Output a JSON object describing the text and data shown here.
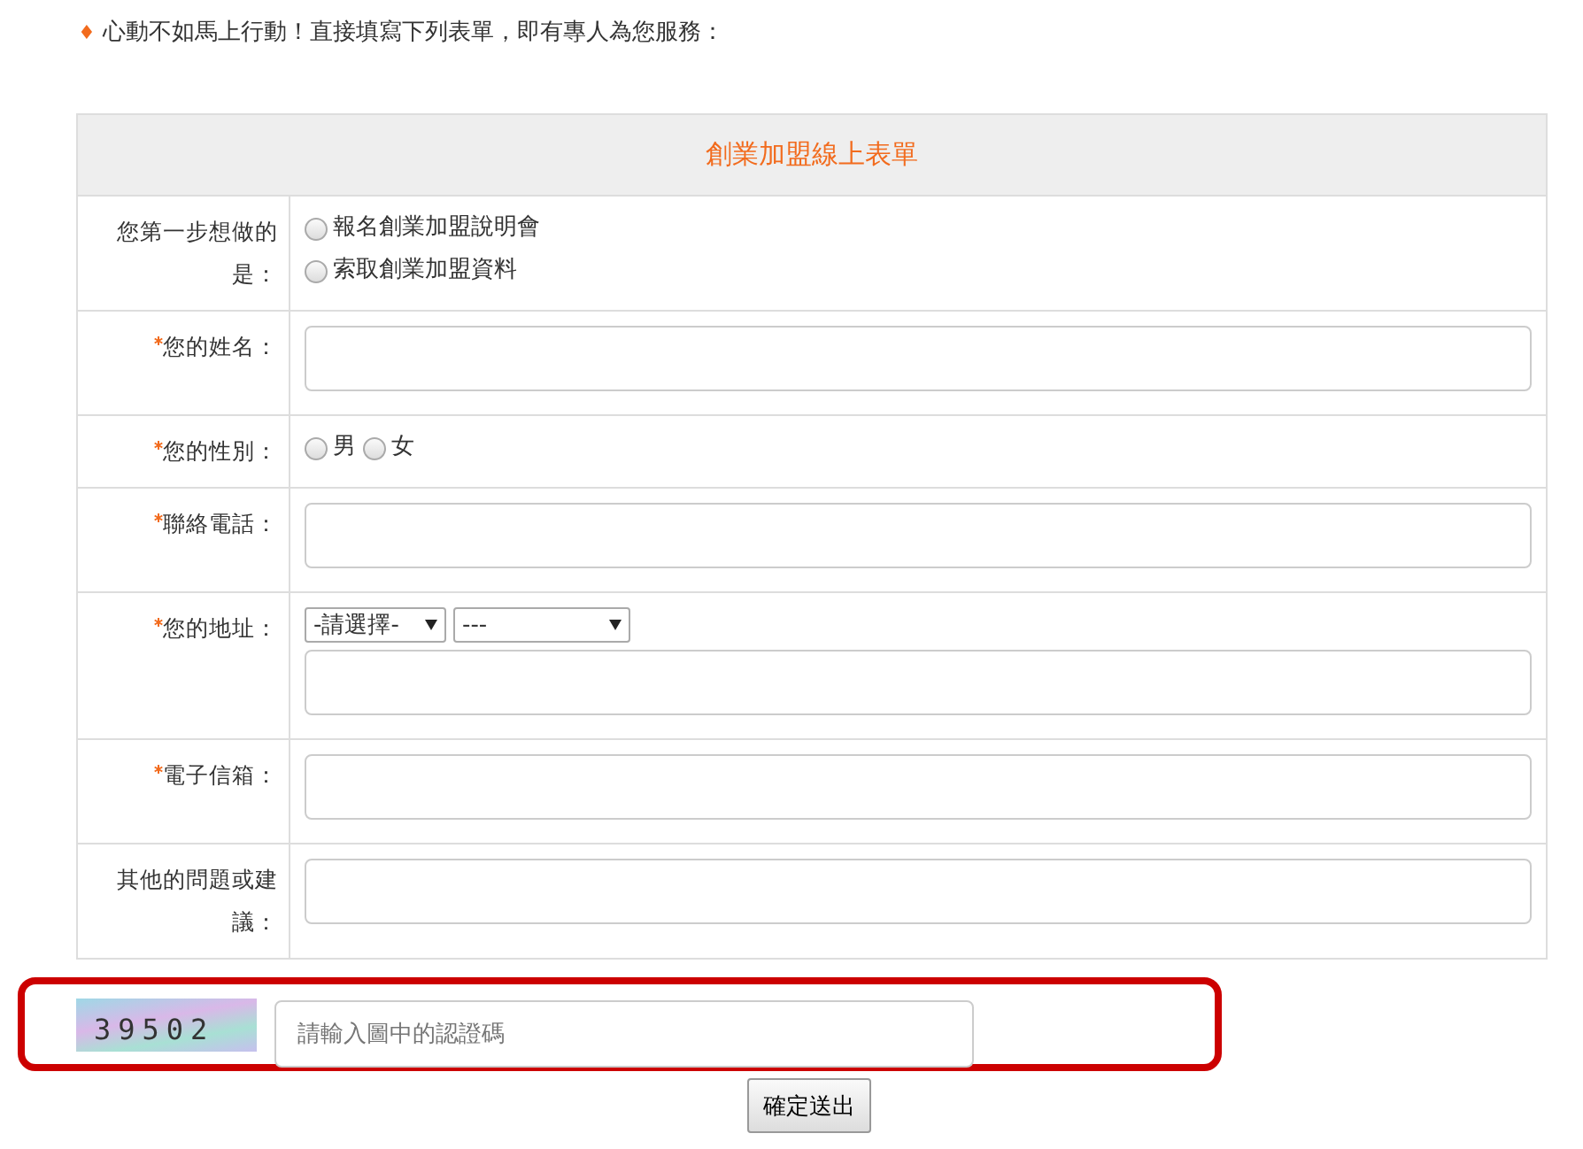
{
  "intro": {
    "bullet": "♦",
    "text": "心動不如馬上行動！直接填寫下列表單，即有專人為您服務："
  },
  "form": {
    "title": "創業加盟線上表單",
    "rows": [
      {
        "kind": "radio-stack",
        "label": "您第一步想做的是：",
        "required": false,
        "options": [
          {
            "label": "報名創業加盟說明會",
            "selected": false
          },
          {
            "label": "索取創業加盟資料",
            "selected": false
          }
        ]
      },
      {
        "kind": "text",
        "label": "您的姓名：",
        "required": true
      },
      {
        "kind": "radio-inline",
        "label": "您的性別：",
        "required": true,
        "options": [
          {
            "label": "男",
            "selected": false
          },
          {
            "label": "女",
            "selected": false
          }
        ]
      },
      {
        "kind": "text",
        "label": "聯絡電話：",
        "required": true
      },
      {
        "kind": "address",
        "label": "您的地址：",
        "required": true,
        "selects": [
          "-請選擇-",
          "---"
        ]
      },
      {
        "kind": "text",
        "label": "電子信箱：",
        "required": true
      },
      {
        "kind": "text",
        "label": "其他的問題或建議：",
        "required": false
      }
    ]
  },
  "captcha": {
    "code": "39502",
    "placeholder": "請輸入圖中的認證碼"
  },
  "submit": "確定送出"
}
